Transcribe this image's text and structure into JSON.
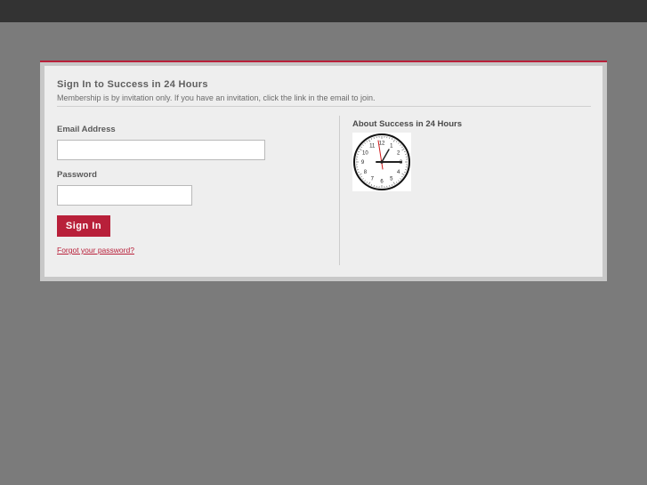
{
  "signin": {
    "title": "Sign In to Success in 24 Hours",
    "subtitle": "Membership is by invitation only. If you have an invitation, click the link in the email to join.",
    "email_label": "Email Address",
    "email_value": "",
    "password_label": "Password",
    "password_value": "",
    "submit_label": "Sign In",
    "forgot_label": "Forgot your password?"
  },
  "about": {
    "title": "About Success in 24 Hours",
    "clock_icon": "clock-icon",
    "clock_numbers": [
      "12",
      "1",
      "2",
      "3",
      "4",
      "5",
      "6",
      "7",
      "8",
      "9",
      "10",
      "11"
    ]
  },
  "colors": {
    "accent": "#b8203a",
    "topbar": "#333333",
    "background": "#7b7b7b",
    "panel": "#eeeeee"
  }
}
